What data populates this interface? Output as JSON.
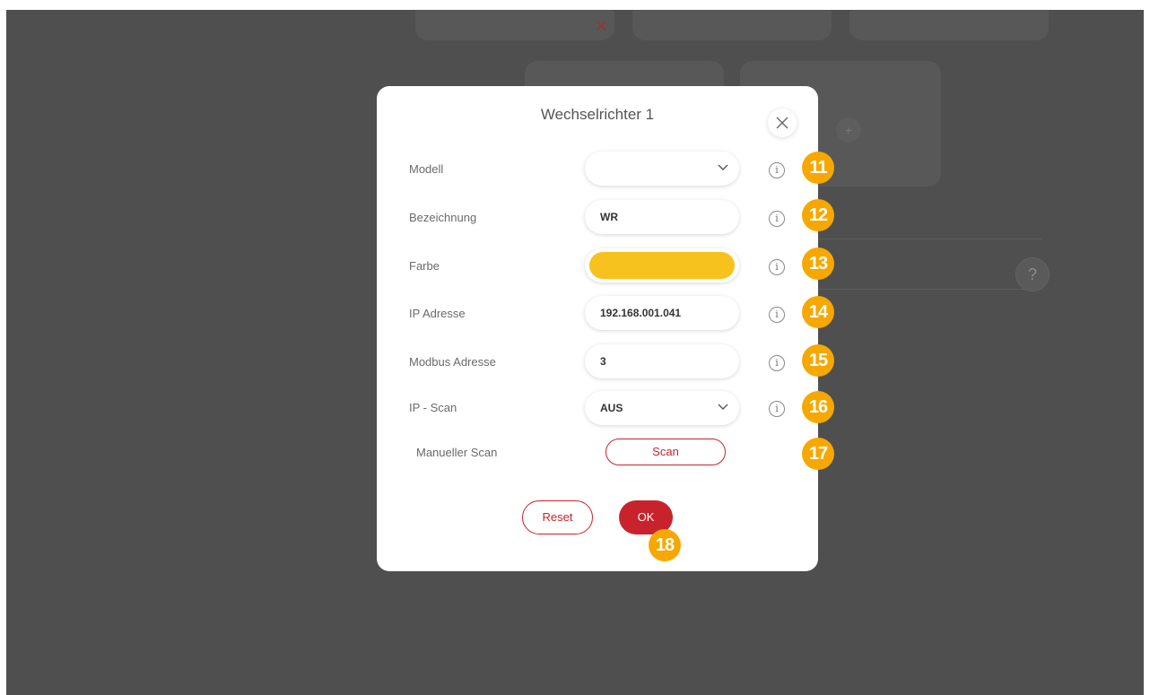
{
  "dialog": {
    "title": "Wechselrichter 1",
    "close_icon": "close-icon",
    "rows": [
      {
        "label": "Modell",
        "value": "",
        "type": "select"
      },
      {
        "label": "Bezeichnung",
        "value": "WR",
        "type": "text"
      },
      {
        "label": "Farbe",
        "value": "",
        "type": "color",
        "color": "#f8c21e"
      },
      {
        "label": "IP Adresse",
        "value": "192.168.001.041",
        "type": "text"
      },
      {
        "label": "Modbus Adresse",
        "value": "3",
        "type": "text"
      },
      {
        "label": "IP - Scan",
        "value": "AUS",
        "type": "select"
      }
    ],
    "info_symbol": "i",
    "manual_scan_label": "Manueller Scan",
    "scan_button": "Scan",
    "reset_button": "Reset",
    "ok_button": "OK"
  },
  "badges": [
    "11",
    "12",
    "13",
    "14",
    "15",
    "16",
    "17",
    "18"
  ],
  "background": {
    "help_symbol": "?",
    "add_symbol": "+",
    "close_symbol": "✕"
  },
  "colors": {
    "accent": "#c8232c",
    "badge": "#f6a800",
    "overlay": "#4f4f4f"
  }
}
